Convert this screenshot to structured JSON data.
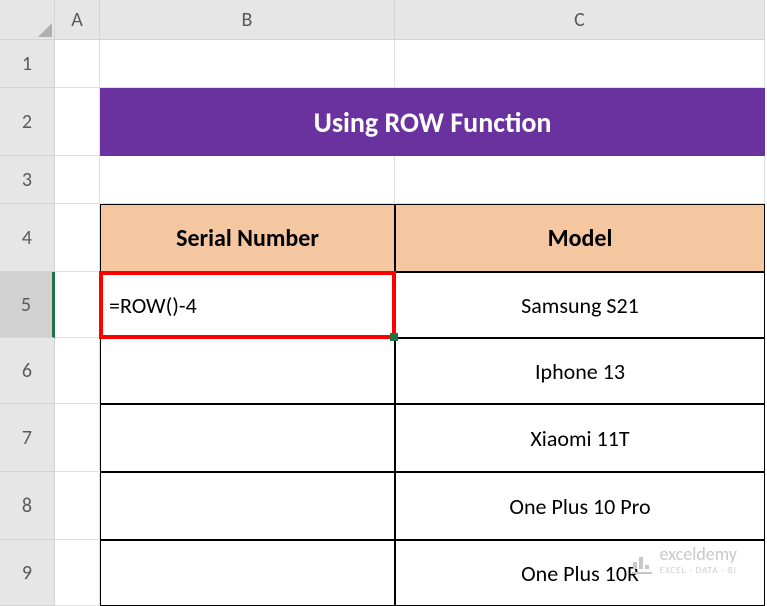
{
  "columns": [
    "A",
    "B",
    "C"
  ],
  "rows": [
    "1",
    "2",
    "3",
    "4",
    "5",
    "6",
    "7",
    "8",
    "9"
  ],
  "title": "Using ROW Function",
  "headers": {
    "serial": "Serial Number",
    "model": "Model"
  },
  "formula": "=ROW()-4",
  "models": [
    "Samsung S21",
    "Iphone 13",
    "Xiaomi 11T",
    "One Plus 10 Pro",
    "One Plus 10R"
  ],
  "watermark": {
    "main": "exceldemy",
    "sub": "EXCEL · DATA · BI"
  },
  "selectedRow": "5"
}
